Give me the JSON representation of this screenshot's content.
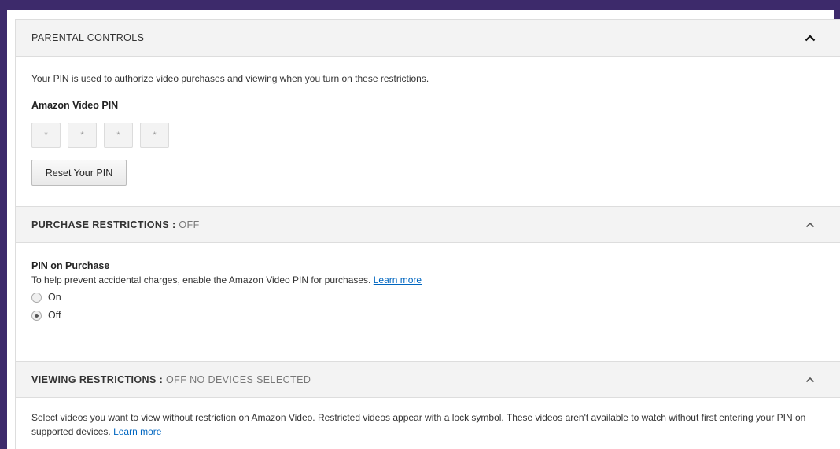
{
  "parental_controls": {
    "header": "PARENTAL CONTROLS",
    "description": "Your PIN is used to authorize video purchases and viewing when you turn on these restrictions.",
    "pin_label": "Amazon Video PIN",
    "pin_digits": [
      "*",
      "*",
      "*",
      "*"
    ],
    "reset_button": "Reset Your PIN",
    "chevron_icon": "chevron-up-icon"
  },
  "purchase_restrictions": {
    "header_title": "PURCHASE RESTRICTIONS",
    "header_colon": ":",
    "header_status": "OFF",
    "option_title": "PIN on Purchase",
    "option_desc": "To help prevent accidental charges, enable the Amazon Video PIN for purchases.",
    "learn_more": "Learn more",
    "radio_on": "On",
    "radio_off": "Off",
    "selected": "Off",
    "chevron_icon": "chevron-up-icon"
  },
  "viewing_restrictions": {
    "header_title": "VIEWING RESTRICTIONS",
    "header_colon": ":",
    "header_status": "OFF NO DEVICES SELECTED",
    "description": "Select videos you want to view without restriction on Amazon Video. Restricted videos appear with a lock symbol. These videos aren't available to watch without first entering your PIN on supported devices.",
    "learn_more": "Learn more",
    "chevron_icon": "chevron-up-icon"
  },
  "colors": {
    "frame": "#3d2a6b",
    "link": "#0066c0",
    "header_bg": "#f3f3f3"
  }
}
